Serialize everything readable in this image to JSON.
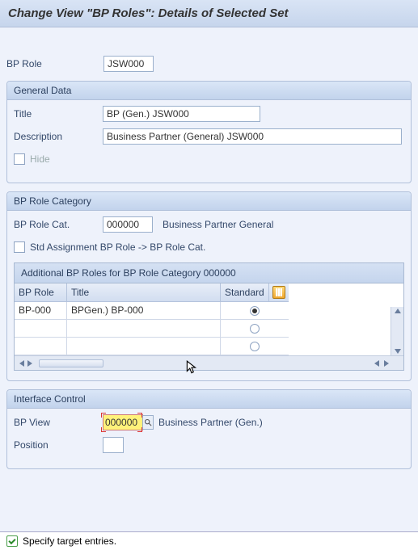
{
  "header": {
    "title": "Change View \"BP Roles\": Details of Selected Set"
  },
  "bp_role": {
    "label": "BP Role",
    "value": "JSW000"
  },
  "general_data": {
    "group_title": "General Data",
    "title_label": "Title",
    "title_value": "BP (Gen.) JSW000",
    "desc_label": "Description",
    "desc_value": "Business Partner (General) JSW000",
    "hide_label": "Hide"
  },
  "bp_role_category": {
    "group_title": "BP Role Category",
    "cat_label": "BP Role Cat.",
    "cat_value": "000000",
    "cat_text": "Business Partner General",
    "std_assign_label": "Std Assignment BP Role -> BP Role Cat.",
    "table": {
      "title": "Additional BP Roles for BP Role Category 000000",
      "col_bprole": "BP Role",
      "col_title": "Title",
      "col_standard": "Standard",
      "rows": [
        {
          "bprole": "BP-000",
          "title": "BPGen.) BP-000",
          "checked": true
        },
        {
          "bprole": "",
          "title": "",
          "checked": false
        },
        {
          "bprole": "",
          "title": "",
          "checked": false
        }
      ]
    }
  },
  "interface_control": {
    "group_title": "Interface Control",
    "bpview_label": "BP View",
    "bpview_value": "000000",
    "bpview_text": "Business Partner (Gen.)",
    "position_label": "Position",
    "position_value": ""
  },
  "status": {
    "msg": "Specify target entries."
  }
}
